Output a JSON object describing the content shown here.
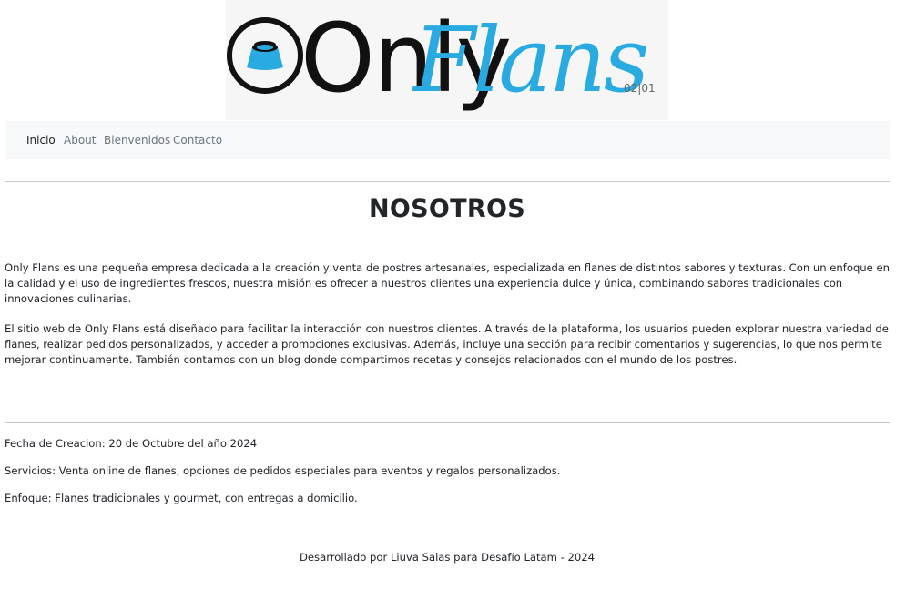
{
  "header": {
    "logo": {
      "text_only": "Only",
      "text_flans": "Flans",
      "tag": "02|01"
    }
  },
  "nav": {
    "items": [
      {
        "label": "Inicio"
      },
      {
        "label": "About"
      },
      {
        "label": "Bienvenidos"
      },
      {
        "label": "Contacto"
      }
    ]
  },
  "main": {
    "title": "NOSOTROS",
    "paragraphs": [
      "Only Flans es una pequeña empresa dedicada a la creación y venta de postres artesanales, especializada en flanes de distintos sabores y texturas. Con un enfoque en la calidad y el uso de ingredientes frescos, nuestra misión es ofrecer a nuestros clientes una experiencia dulce y única, combinando sabores tradicionales con innovaciones culinarias.",
      "El sitio web de Only Flans está diseñado para facilitar la interacción con nuestros clientes. A través de la plataforma, los usuarios pueden explorar nuestra variedad de flanes, realizar pedidos personalizados, y acceder a promociones exclusivas. Además, incluye una sección para recibir comentarios y sugerencias, lo que nos permite mejorar continuamente. También contamos con un blog donde compartimos recetas y consejos relacionados con el mundo de los postres."
    ]
  },
  "info": {
    "fecha": "Fecha de Creacion: 20 de Octubre del año 2024",
    "servicios": "Servicios: Venta online de flanes, opciones de pedidos especiales para eventos y regalos personalizados.",
    "enfoque": "Enfoque: Flanes tradicionales y gourmet, con entregas a domicilio."
  },
  "footer": {
    "text": "Desarrollado por Liuva Salas para Desafío Latam - 2024"
  },
  "colors": {
    "brand_blue": "#29abe2",
    "logo_dark": "#111111",
    "navbar_bg": "#f8f9fa"
  }
}
